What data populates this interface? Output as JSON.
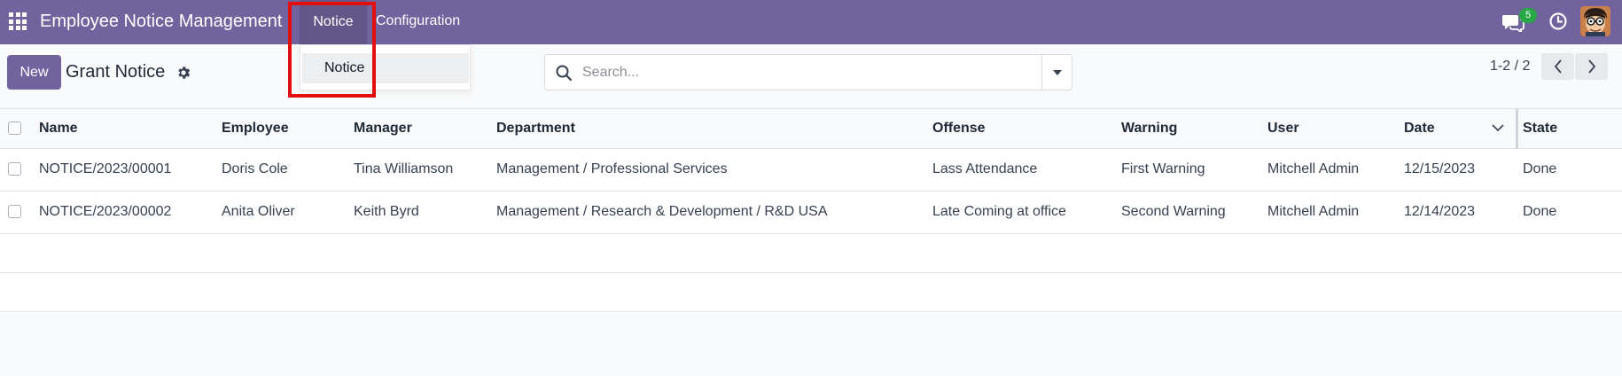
{
  "topbar": {
    "app_title": "Employee Notice Management",
    "menu": [
      "Notice",
      "Configuration"
    ],
    "message_count": "5",
    "colors": {
      "brand": "#71639e",
      "badge": "#28a745",
      "highlight": "#e30e0e"
    }
  },
  "dropdown": {
    "items": [
      "Notice"
    ]
  },
  "controlbar": {
    "new_label": "New",
    "title": "Grant Notice",
    "search_placeholder": "Search...",
    "pager": "1-2 / 2"
  },
  "table": {
    "headers": [
      "Name",
      "Employee",
      "Manager",
      "Department",
      "Offense",
      "Warning",
      "User",
      "Date",
      "State"
    ],
    "rows": [
      [
        "NOTICE/2023/00001",
        "Doris Cole",
        "Tina Williamson",
        "Management / Professional Services",
        "Lass Attendance",
        "First Warning",
        "Mitchell Admin",
        "12/15/2023",
        "Done"
      ],
      [
        "NOTICE/2023/00002",
        "Anita Oliver",
        "Keith Byrd",
        "Management / Research & Development / R&D USA",
        "Late Coming at office",
        "Second Warning",
        "Mitchell Admin",
        "12/14/2023",
        "Done"
      ]
    ]
  },
  "icons": [
    "apps-icon",
    "chat-icon",
    "clock-icon",
    "avatar",
    "gear-icon",
    "search-icon",
    "caret-down-icon",
    "chevron-left-icon",
    "chevron-right-icon",
    "sort-chevron-down-icon"
  ]
}
